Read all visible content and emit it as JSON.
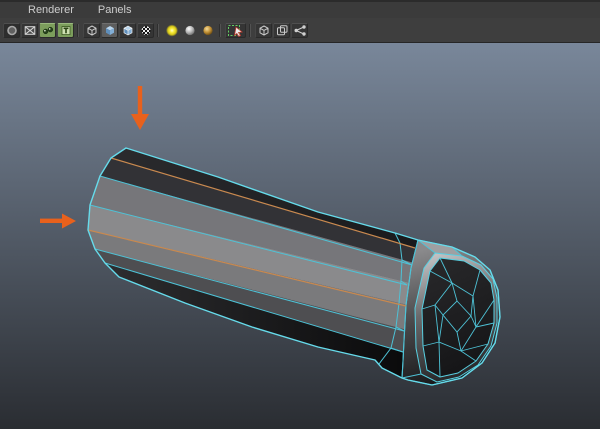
{
  "menubar": {
    "items": [
      {
        "label": "Renderer"
      },
      {
        "label": "Panels"
      }
    ]
  },
  "toolbar": {
    "buttons": [
      {
        "name": "select-camera",
        "icon": "circle-icon",
        "state": "pressed"
      },
      {
        "name": "film-gate",
        "icon": "x-box-icon",
        "state": "normal"
      },
      {
        "name": "resolution-gate",
        "icon": "green-dots-icon",
        "state": "normal"
      },
      {
        "name": "gate-mask",
        "icon": "green-t-icon",
        "state": "normal"
      },
      {
        "name": "wireframe-mode",
        "icon": "wire-cube-icon",
        "state": "normal"
      },
      {
        "name": "smooth-shade-all",
        "icon": "shaded-cube-icon",
        "state": "active"
      },
      {
        "name": "shade-wireframe",
        "icon": "shaded-wire-cube-icon",
        "state": "normal"
      },
      {
        "name": "textured-mode",
        "icon": "checker-sphere-icon",
        "state": "normal"
      },
      {
        "name": "default-lighting",
        "icon": "yellow-light-icon",
        "state": "normal"
      },
      {
        "name": "flat-lighting",
        "icon": "gray-sphere-icon",
        "state": "normal"
      },
      {
        "name": "all-lights",
        "icon": "gold-sphere-icon",
        "state": "normal"
      },
      {
        "name": "isolate-select",
        "icon": "dashed-box-cursor-icon",
        "state": "normal"
      },
      {
        "name": "xray-mode",
        "icon": "wire-cube-icon",
        "state": "normal"
      },
      {
        "name": "xray-active-components",
        "icon": "double-square-icon",
        "state": "normal"
      },
      {
        "name": "node-connections",
        "icon": "share-nodes-icon",
        "state": "normal"
      }
    ]
  },
  "viewport": {
    "background_gradient_top": "#79879a",
    "background_gradient_bottom": "#2a2d32",
    "model": {
      "name": "beveled-polygon-cylinder",
      "display_mode": "smooth-shaded-with-wireframe",
      "wireframe_color": "#55cadd",
      "selected_edge_color": "#c9894f",
      "selected_edge_count": 2
    },
    "annotations": {
      "arrow_color": "#e8611c",
      "arrows": [
        {
          "direction": "down",
          "target": "upper selected edge loop"
        },
        {
          "direction": "right",
          "target": "lower selected edge loop"
        }
      ]
    }
  }
}
